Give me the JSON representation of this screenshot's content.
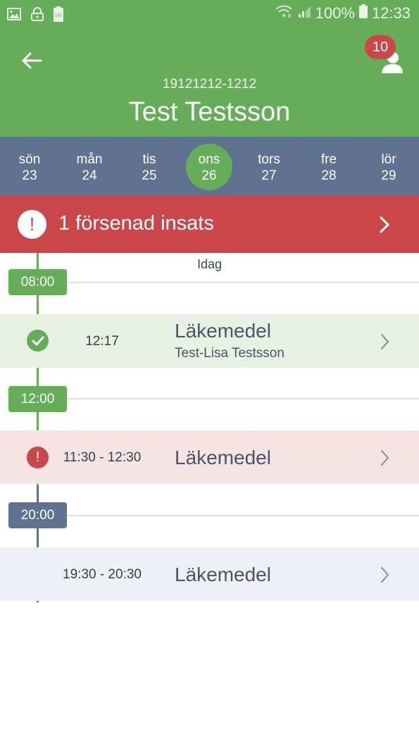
{
  "status_bar": {
    "left_icons": [
      "image-icon",
      "lock-icon",
      "battery-saver-icon"
    ],
    "battery_saver_label": "100",
    "battery_percent": "100%",
    "time": "12:33"
  },
  "header": {
    "back_icon": "arrow-left-icon",
    "patient_id": "19121212-1212",
    "patient_name": "Test Testsson",
    "notification_count": "10",
    "user_icon": "person-icon"
  },
  "week": {
    "days": [
      {
        "name": "sön",
        "date": "23",
        "active": false
      },
      {
        "name": "mån",
        "date": "24",
        "active": false
      },
      {
        "name": "tis",
        "date": "25",
        "active": false
      },
      {
        "name": "ons",
        "date": "26",
        "active": true
      },
      {
        "name": "tors",
        "date": "27",
        "active": false
      },
      {
        "name": "fre",
        "date": "28",
        "active": false
      },
      {
        "name": "lör",
        "date": "29",
        "active": false
      }
    ]
  },
  "alert": {
    "icon": "exclamation-icon",
    "text": "1 försenad insats",
    "chevron": "chevron-right-icon"
  },
  "timeline": {
    "today_label": "Idag",
    "hours": [
      {
        "label": "08:00",
        "state": "done"
      },
      {
        "label": "12:00",
        "state": "done"
      },
      {
        "label": "20:00",
        "state": "upcoming"
      }
    ],
    "items": [
      {
        "time": "12:17",
        "title": "Läkemedel",
        "subtitle": "Test-Lisa Testsson",
        "status": "done"
      },
      {
        "time": "11:30 - 12:30",
        "title": "Läkemedel",
        "subtitle": "",
        "status": "late"
      },
      {
        "time": "19:30 - 20:30",
        "title": "Läkemedel",
        "subtitle": "",
        "status": "upcoming"
      }
    ]
  },
  "colors": {
    "brand_green": "#66ad5a",
    "week_bar": "#5f728f",
    "alert_red": "#c94748",
    "done_row_bg": "#e8f2e4",
    "late_row_bg": "#f6e3e3",
    "upcoming_row_bg": "#eef0f5",
    "upcoming_tag": "#5f728f"
  }
}
